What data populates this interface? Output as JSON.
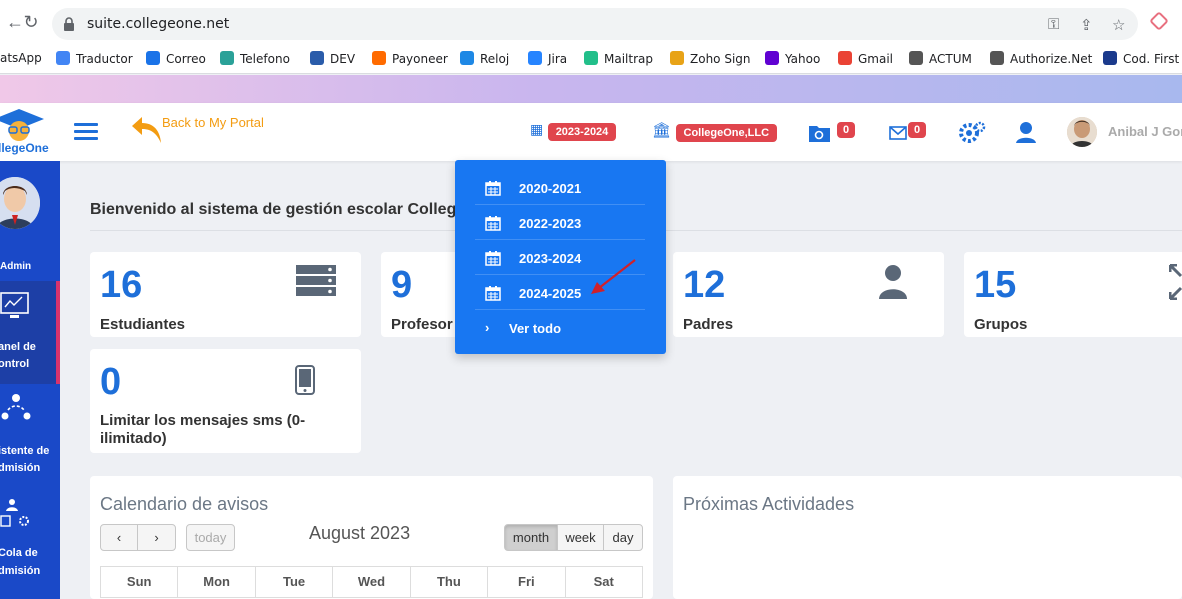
{
  "browser": {
    "url": "suite.collegeone.net",
    "bookmarks": [
      {
        "label": "atsApp",
        "icon": "whatsapp-icon",
        "color": "#25d366"
      },
      {
        "label": "Traductor",
        "icon": "google-icon",
        "color": "#4285f4"
      },
      {
        "label": "Correo",
        "icon": "mail-icon",
        "color": "#1a73e8"
      },
      {
        "label": "Telefono",
        "icon": "cloud-icon",
        "color": "#2aa198"
      },
      {
        "label": "DEV",
        "icon": "house-icon",
        "color": "#2a5caa"
      },
      {
        "label": "Payoneer",
        "icon": "payoneer-icon",
        "color": "#ff6b00"
      },
      {
        "label": "Reloj",
        "icon": "clock-icon",
        "color": "#1e88e5"
      },
      {
        "label": "Jira",
        "icon": "jira-icon",
        "color": "#2684ff"
      },
      {
        "label": "Mailtrap",
        "icon": "mailtrap-icon",
        "color": "#22bf8a"
      },
      {
        "label": "Zoho Sign",
        "icon": "zoho-icon",
        "color": "#e8a317"
      },
      {
        "label": "Yahoo",
        "icon": "yahoo-icon",
        "color": "#6001d2"
      },
      {
        "label": "Gmail",
        "icon": "gmail-icon",
        "color": "#ea4335"
      },
      {
        "label": "ACTUM",
        "icon": "globe-icon",
        "color": "#555555"
      },
      {
        "label": "Authorize.Net",
        "icon": "globe-icon",
        "color": "#555555"
      },
      {
        "label": "Cod. First I",
        "icon": "codefirst-icon",
        "color": "#1b3a8c"
      }
    ]
  },
  "header": {
    "logo_text": "llegeOne",
    "back_label": "Back to My Portal",
    "year_badge": "2023-2024",
    "college_badge": "CollegeOne,LLC",
    "folder_count": "0",
    "mail_count": "0",
    "user_name": "Anibal J Gon"
  },
  "sidebar": {
    "role": "Admin",
    "items": [
      {
        "label_line1": "anel de",
        "label_line2": "ontrol"
      },
      {
        "label_line1": "istente de",
        "label_line2": "dmisión"
      },
      {
        "label_line1": "Cola de",
        "label_line2": "dmisión"
      }
    ]
  },
  "main": {
    "welcome": "Bienvenido al sistema de gestión escolar College",
    "cards": [
      {
        "value": "16",
        "label": "Estudiantes"
      },
      {
        "value": "9",
        "label": "Profesor"
      },
      {
        "value": "12",
        "label": "Padres"
      },
      {
        "value": "15",
        "label": "Grupos"
      },
      {
        "value": "0",
        "label_line1": "Limitar los mensajes sms (0-",
        "label_line2": "ilimitado)"
      }
    ]
  },
  "calendar": {
    "title": "Calendario de avisos",
    "prev": "‹",
    "next": "›",
    "today": "today",
    "month_title": "August 2023",
    "views": [
      "month",
      "week",
      "day"
    ],
    "days": [
      "Sun",
      "Mon",
      "Tue",
      "Wed",
      "Thu",
      "Fri",
      "Sat"
    ]
  },
  "activities": {
    "title": "Próximas Actividades"
  },
  "year_dropdown": {
    "items": [
      "2020-2021",
      "2022-2023",
      "2023-2024",
      "2024-2025"
    ],
    "see_all": "Ver todo"
  },
  "colors": {
    "sidebar": "#1a49c8",
    "accent_blue": "#1e6fd9",
    "dropdown": "#1877f2",
    "badge_red": "#e0454d",
    "back_orange": "#f39c12"
  }
}
